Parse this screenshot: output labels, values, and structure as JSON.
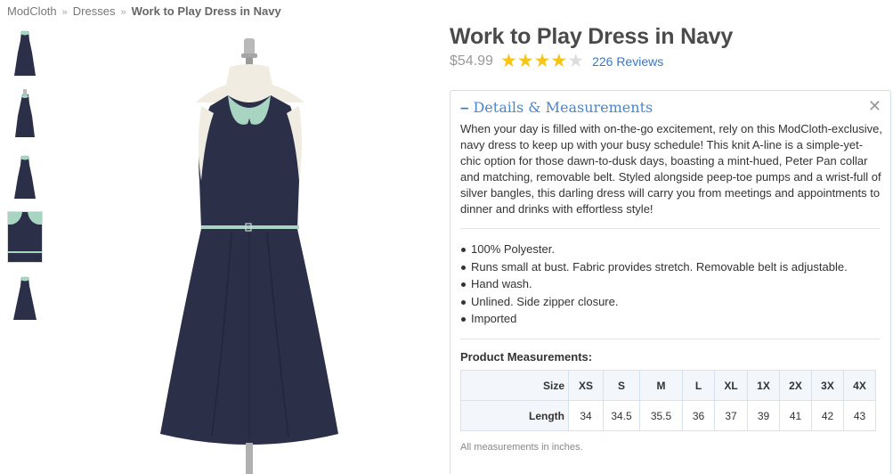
{
  "breadcrumb": {
    "items": [
      "ModCloth",
      "Dresses"
    ],
    "separator": "»",
    "current": "Work to Play Dress in Navy"
  },
  "product": {
    "title": "Work to Play Dress in Navy",
    "price": "$54.99",
    "rating": 4,
    "rating_max": 5,
    "reviews_label": "226 Reviews"
  },
  "thumbnails": [
    "thumb-front",
    "thumb-side",
    "thumb-back",
    "thumb-detail-collar",
    "thumb-full"
  ],
  "details": {
    "heading": "Details & Measurements",
    "collapse_icon": "minus-icon",
    "close_icon": "close-icon",
    "description": "When your day is filled with on-the-go excitement, rely on this ModCloth-exclusive, navy dress to keep up with your busy schedule! This knit A-line is a simple-yet-chic option for those dawn-to-dusk days, boasting a mint-hued, Peter Pan collar and matching, removable belt. Styled alongside peep-toe pumps and a wrist-full of silver bangles, this darling dress will carry you from meetings and appointments to dinner and drinks with effortless style!",
    "bullets": [
      "100% Polyester.",
      "Runs small at bust. Fabric provides stretch. Removable belt is adjustable.",
      "Hand wash.",
      "Unlined. Side zipper closure.",
      "Imported"
    ],
    "measurements_title": "Product Measurements:",
    "measurements": {
      "size_label": "Size",
      "length_label": "Length",
      "sizes": [
        "XS",
        "S",
        "M",
        "L",
        "XL",
        "1X",
        "2X",
        "3X",
        "4X"
      ],
      "lengths": [
        "34",
        "34.5",
        "35.5",
        "36",
        "37",
        "39",
        "41",
        "42",
        "43"
      ]
    },
    "note": "All measurements in inches."
  },
  "colors": {
    "accent_link": "#3a78c3",
    "star": "#f5c518",
    "dress_navy": "#2b2f48",
    "collar_mint": "#a8d5c2"
  }
}
